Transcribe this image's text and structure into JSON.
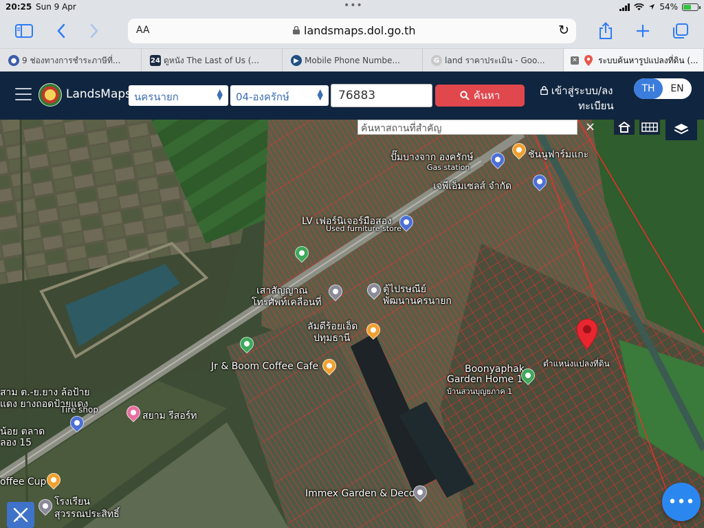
{
  "status_bar": {
    "time": "20:25",
    "date": "Sun 9 Apr",
    "battery": "54%"
  },
  "browser": {
    "aa_label": "AA",
    "url": "landsmaps.dol.go.th",
    "tabs": [
      {
        "title": "9 ช่องทางการชำระภาษีที่...",
        "active": false
      },
      {
        "title": "ดูหนัง The Last of Us (...",
        "active": false
      },
      {
        "title": "Mobile Phone Numbe...",
        "active": false
      },
      {
        "title": "land ราคาประเมิน - Goo...",
        "active": false
      },
      {
        "title": "ระบบค้นหารูปแปลงที่ดิน (...",
        "active": true
      }
    ]
  },
  "header": {
    "brand": "LandsMaps",
    "province": "นครนายก",
    "district": "04-องครักษ์",
    "parcel_number": "76883",
    "search_label": "ค้นหา",
    "login_line1": "เข้าสู่ระบบ/ลง",
    "login_line2": "ทะเบียน",
    "lang_th": "TH",
    "lang_en": "EN"
  },
  "map": {
    "place_search_placeholder": "ค้นหาสถานที่สำคัญ",
    "close_symbol": "×",
    "labels": {
      "gas_station_th": "ปั๊มบางจาก องครักษ์",
      "gas_station_en": "Gas station",
      "farm": "ชันนูฟาร์มแกะ",
      "jp_sales": "เจพีเอ็มเซลส์ จำกัด",
      "lv_furniture": "LV เฟอร์นิเจอร์มือสอง",
      "lv_furniture_en": "Used furniture store",
      "phone_tower_1": "เสาสัญญาณ",
      "phone_tower_2": "โทรศัพท์เคลื่อนที่",
      "post_1": "ตู้ไปรษณีย์",
      "post_2": "พัฒนานครนายก",
      "restaurant_1": "ลัมดีร้อยเอ็ด",
      "restaurant_2": "ปทุมธานี",
      "coffee": "Jr & Boom Coffee Cafe",
      "boonyaphak_1": "Boonyaphak",
      "boonyaphak_2": "Garden Home 1",
      "boonyaphak_th": "บ้านสวนบุญยภาค 1",
      "parcel_marker": "ตำแหน่งแปลงที่ดิน",
      "left_1": "สาม ต.-ย.ยาง ล้อป้าย",
      "left_2": "แดง ยางถอดป้ายแดง",
      "tire_shop": "Tire shop",
      "left_3": "น้อย ตลาด",
      "left_4": "ลอง 15",
      "resort": "สยาม รีสอร์ท",
      "coffee_cup": "offee Cup",
      "school_1": "โรงเรียน",
      "school_2": "สุวรรณประสิทธิ์",
      "immex": "Immex Garden & Decor"
    },
    "fab_symbol": "•••"
  },
  "colors": {
    "header_bg": "#10253f",
    "search_red": "#e0484d",
    "lang_blue": "#3b7ddd",
    "parcel_line": "#ff2a2a"
  }
}
